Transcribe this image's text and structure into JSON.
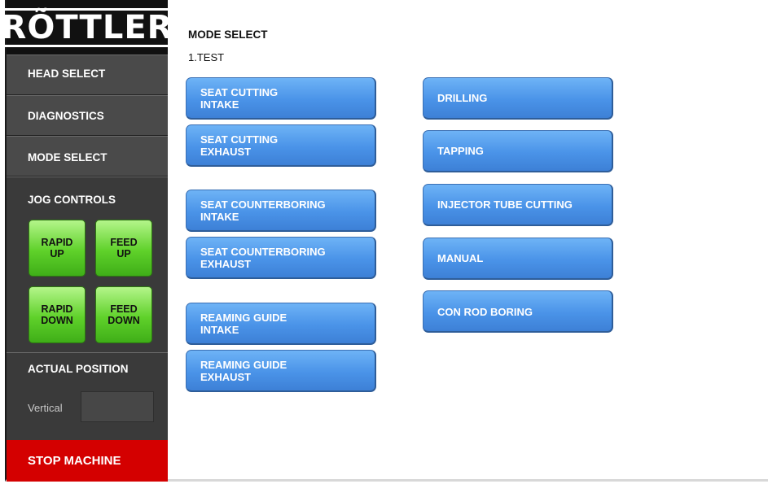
{
  "logo": {
    "text": "RÕTTLER"
  },
  "sidebar": {
    "nav": [
      {
        "label": "HEAD SELECT"
      },
      {
        "label": "DIAGNOSTICS"
      },
      {
        "label": "MODE SELECT"
      }
    ],
    "jog": {
      "title": "JOG CONTROLS",
      "buttons": [
        {
          "label": "RAPID\nUP"
        },
        {
          "label": "FEED\nUP"
        },
        {
          "label": "RAPID\nDOWN"
        },
        {
          "label": "FEED\nDOWN"
        }
      ]
    },
    "actual_position": {
      "title": "ACTUAL POSITION",
      "vertical_label": "Vertical",
      "vertical_value": ""
    },
    "stop_label": "STOP MACHINE"
  },
  "main": {
    "title": "MODE SELECT",
    "subtitle": "1.TEST",
    "left_buttons": [
      {
        "line1": "SEAT CUTTING",
        "line2": "INTAKE"
      },
      {
        "line1": "SEAT CUTTING",
        "line2": "EXHAUST"
      },
      {
        "line1": "SEAT COUNTERBORING",
        "line2": "INTAKE"
      },
      {
        "line1": "SEAT COUNTERBORING",
        "line2": "EXHAUST"
      },
      {
        "line1": "REAMING GUIDE",
        "line2": "INTAKE"
      },
      {
        "line1": "REAMING GUIDE",
        "line2": "EXHAUST"
      }
    ],
    "right_buttons": [
      {
        "label": "DRILLING"
      },
      {
        "label": "TAPPING"
      },
      {
        "label": "INJECTOR TUBE CUTTING"
      },
      {
        "label": "MANUAL"
      },
      {
        "label": "CON ROD BORING"
      }
    ]
  },
  "colors": {
    "sidebar_bg": "#3a3a3a",
    "jog_green": "#5fd12a",
    "mode_blue": "#4a93e8",
    "stop_red": "#d40000"
  }
}
